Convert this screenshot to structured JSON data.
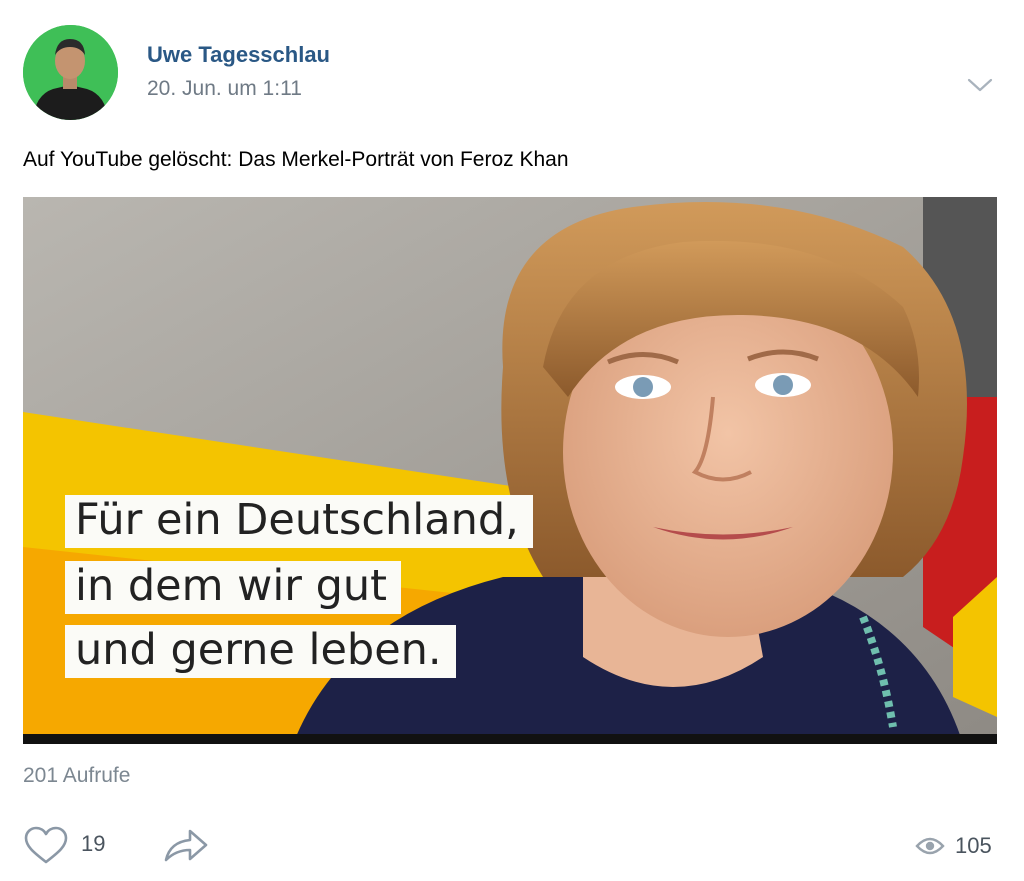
{
  "post": {
    "author": "Uwe Tagesschlau",
    "date": "20. Jun. um 1:11",
    "text": "Auf YouTube gelöscht: Das Merkel-Porträt von Feroz Khan"
  },
  "media": {
    "slogan_lines": [
      "Für ein Deutschland,",
      "in dem wir gut",
      "und gerne leben."
    ]
  },
  "stats": {
    "views_label": "201 Aufrufe",
    "likes": "19",
    "views": "105"
  },
  "colors": {
    "author_link": "#2a5885",
    "avatar_bg": "#3fbf57",
    "muted": "#7c8791"
  }
}
